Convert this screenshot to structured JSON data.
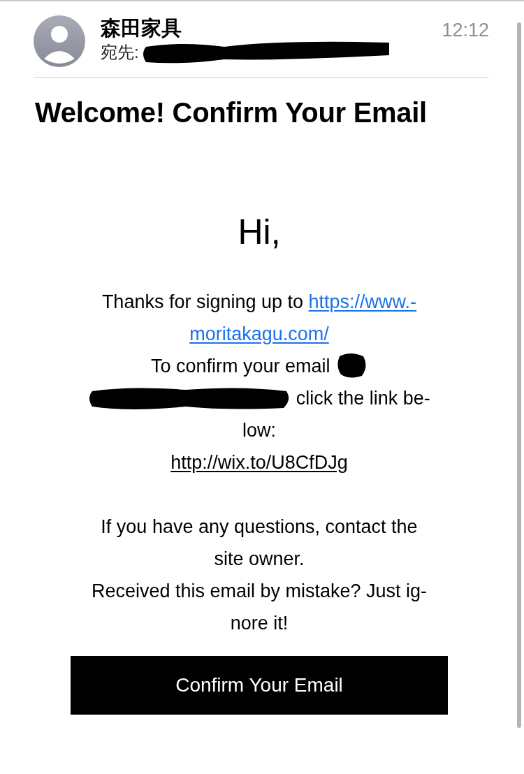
{
  "header": {
    "sender": "森田家具",
    "to_label": "宛先:",
    "time": "12:12"
  },
  "subject": "Welcome! Confirm Your Email",
  "greeting": "Hi,",
  "paragraphs": [
    {
      "lines": [
        {
          "segments": [
            {
              "kind": "text",
              "text": "Thanks for signing up to "
            },
            {
              "kind": "link",
              "text": "https://www.-"
            }
          ]
        },
        {
          "segments": [
            {
              "kind": "link",
              "text": "moritakagu.com/"
            }
          ]
        },
        {
          "segments": [
            {
              "kind": "text",
              "text": "To confirm your email "
            },
            {
              "kind": "blot"
            }
          ]
        },
        {
          "segments": [
            {
              "kind": "smear"
            },
            {
              "kind": "text",
              "text": " click the link be-"
            }
          ]
        },
        {
          "segments": [
            {
              "kind": "text",
              "text": "low:"
            }
          ]
        },
        {
          "segments": [
            {
              "kind": "url",
              "text": "http://wix.to/U8CfDJg"
            }
          ]
        }
      ]
    },
    {
      "lines": [
        {
          "segments": [
            {
              "kind": "text",
              "text": "If you have any questions, contact the"
            }
          ]
        },
        {
          "segments": [
            {
              "kind": "text",
              "text": "site owner."
            }
          ]
        },
        {
          "segments": [
            {
              "kind": "text",
              "text": "Received this email by mistake? Just ig-"
            }
          ]
        },
        {
          "segments": [
            {
              "kind": "text",
              "text": "nore it!"
            }
          ]
        }
      ]
    }
  ],
  "button": "Confirm Your Email"
}
